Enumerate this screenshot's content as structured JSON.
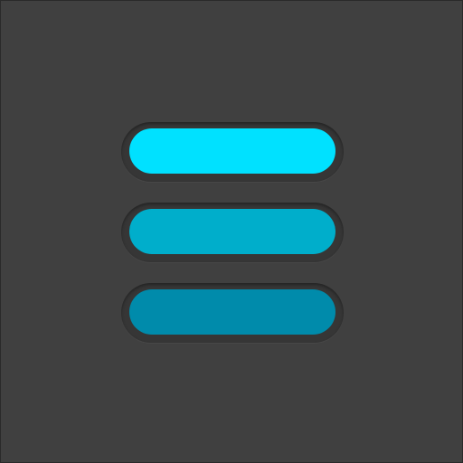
{
  "icon": {
    "name": "hamburger-menu-icon",
    "background_color": "#404040",
    "well_color": "#363636",
    "bars": [
      {
        "name": "menu-bar-top",
        "color": "#00e1ff"
      },
      {
        "name": "menu-bar-middle",
        "color": "#00aecb"
      },
      {
        "name": "menu-bar-bottom",
        "color": "#008bab"
      }
    ]
  }
}
